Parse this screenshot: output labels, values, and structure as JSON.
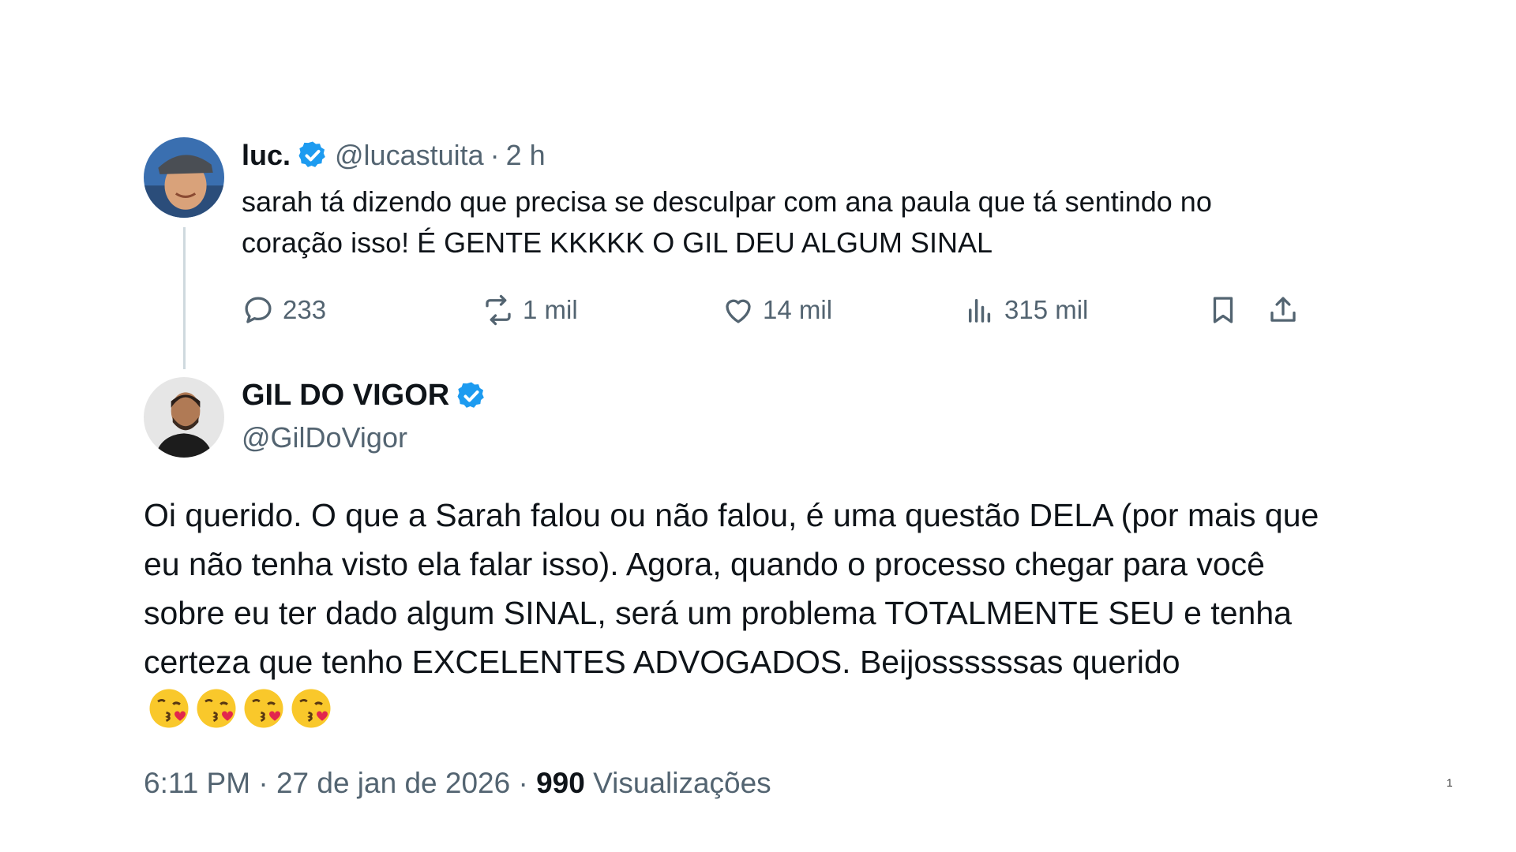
{
  "quoted": {
    "name": "luc.",
    "handle": "@lucastuita",
    "separator": "·",
    "time": "2 h",
    "text": "sarah tá dizendo que precisa se desculpar com ana paula que tá sentindo no coração isso! É GENTE KKKKK O GIL DEU ALGUM SINAL",
    "actions": {
      "replies": "233",
      "reposts": "1 mil",
      "likes": "14 mil",
      "views": "315 mil"
    }
  },
  "main": {
    "name": "GIL DO VIGOR",
    "handle": "@GilDoVigor",
    "text": "Oi querido. O que a Sarah falou ou não falou, é uma questão DELA (por mais que eu não tenha visto ela falar isso). Agora, quando o processo chegar para você sobre eu ter dado algum SINAL, será um problema TOTALMENTE SEU e tenha certeza que tenho EXCELENTES ADVOGADOS. Beijossssssas querido",
    "emoji_count": 4,
    "emoji_name": "face-blowing-a-kiss"
  },
  "meta": {
    "time": "6:11 PM",
    "date": "27 de jan de 2026",
    "separator": "·",
    "views_count": "990",
    "views_label": "Visualizações"
  },
  "page_number": "1",
  "colors": {
    "text": "#0f1419",
    "muted": "#536471",
    "verified": "#1d9bf0",
    "thread_line": "#cfd9de"
  }
}
